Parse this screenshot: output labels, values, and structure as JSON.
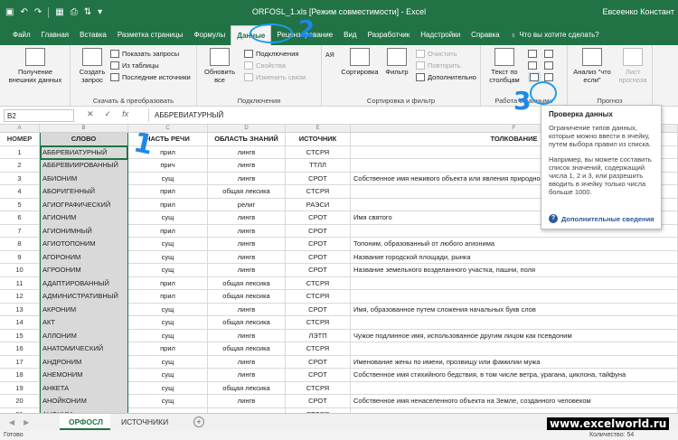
{
  "title_bar": {
    "document_title": "ORFOSL_1.xls [Режим совместимости] - Excel",
    "user": "Евсеенко Констант"
  },
  "tabs": [
    {
      "label": "Файл"
    },
    {
      "label": "Главная"
    },
    {
      "label": "Вставка"
    },
    {
      "label": "Разметка страницы"
    },
    {
      "label": "Формулы"
    },
    {
      "label": "Данные",
      "active": true
    },
    {
      "label": "Рецензирование"
    },
    {
      "label": "Вид"
    },
    {
      "label": "Разработчик"
    },
    {
      "label": "Надстройки"
    },
    {
      "label": "Справка"
    }
  ],
  "tell_me": "Что вы хотите сделать?",
  "ribbon": {
    "get_external": "Получение внешних данных",
    "create_query": "Создать запрос",
    "show_queries": "Показать запросы",
    "from_table": "Из таблицы",
    "recent_sources": "Последние источники",
    "group_get_transform": "Скачать & преобразовать",
    "refresh_all": "Обновить все",
    "connections": "Подключения",
    "properties": "Свойства",
    "edit_links": "Изменить связи",
    "group_connections": "Подключения",
    "sort_az": "АЯ",
    "sort": "Сортировка",
    "filter": "Фильтр",
    "clear": "Очистить",
    "reapply": "Повторить",
    "advanced": "Дополнительно",
    "group_sort_filter": "Сортировка и фильтр",
    "text_to_columns": "Текст по столбцам",
    "group_data_tools": "Работа с данными",
    "what_if": "Анализ \"что если\"",
    "forecast_sheet": "Лист прогноза",
    "group_forecast": "Прогноз"
  },
  "formula_bar": {
    "name_box": "B2",
    "fx": "fx",
    "value": "АББРЕВИАТУРНЫЙ"
  },
  "columns": [
    "A",
    "B",
    "C",
    "D",
    "E",
    "F"
  ],
  "headers": [
    "НОМЕР",
    "СЛОВО",
    "ЧАСТЬ РЕЧИ",
    "ОБЛАСТЬ ЗНАНИЙ",
    "ИСТОЧНИК",
    "ТОЛКОВАНИЕ"
  ],
  "rows": [
    [
      "1",
      "АББРЕВИАТУРНЫЙ",
      "прил",
      "лингв",
      "СТСРЯ",
      ""
    ],
    [
      "2",
      "АББРЕВИИРОВАННЫЙ",
      "прич",
      "лингв",
      "ТТЛЛ",
      ""
    ],
    [
      "3",
      "АБИОНИМ",
      "сущ",
      "лингв",
      "СРОТ",
      "Собственное имя неживого объекта или явления природного мира"
    ],
    [
      "4",
      "АБОРИГЕННЫЙ",
      "прил",
      "общая лексика",
      "СТСРЯ",
      ""
    ],
    [
      "5",
      "АГИОГРАФИЧЕСКИЙ",
      "прил",
      "религ",
      "РАЭСИ",
      ""
    ],
    [
      "6",
      "АГИОНИМ",
      "сущ",
      "лингв",
      "СРОТ",
      "Имя святого"
    ],
    [
      "7",
      "АГИОНИМНЫЙ",
      "прил",
      "лингв",
      "СРОТ",
      ""
    ],
    [
      "8",
      "АГИОТОПОНИМ",
      "сущ",
      "лингв",
      "СРОТ",
      "Топоним, образованный от любого агионима"
    ],
    [
      "9",
      "АГОРОНИМ",
      "сущ",
      "лингв",
      "СРОТ",
      "Название городской площади, рынка"
    ],
    [
      "10",
      "АГРООНИМ",
      "сущ",
      "лингв",
      "СРОТ",
      "Название земельного возделанного участка, пашни, поля"
    ],
    [
      "11",
      "АДАПТИРОВАННЫЙ",
      "прил",
      "общая лексика",
      "СТСРЯ",
      ""
    ],
    [
      "12",
      "АДМИНИСТРАТИВНЫЙ",
      "прил",
      "общая лексика",
      "СТСРЯ",
      ""
    ],
    [
      "13",
      "АКРОНИМ",
      "сущ",
      "лингв",
      "СРОТ",
      "Имя, образованное путем сложения начальных букв слов"
    ],
    [
      "14",
      "АКТ",
      "сущ",
      "общая лексика",
      "СТСРЯ",
      ""
    ],
    [
      "15",
      "АЛЛОНИМ",
      "сущ",
      "лингв",
      "ЛЭТП",
      "Чужое подлинное имя, использованное другим лицом как псевдоним"
    ],
    [
      "16",
      "АНАТОМИЧЕСКИЙ",
      "прил",
      "общая лексика",
      "СТСРЯ",
      ""
    ],
    [
      "17",
      "АНДРОНИМ",
      "сущ",
      "лингв",
      "СРОТ",
      "Именование жены по имени, прозвищу или фамилии мужа"
    ],
    [
      "18",
      "АНЕМОНИМ",
      "сущ",
      "лингв",
      "СРОТ",
      "Собственное имя стихийного бедствия, в том числе ветра, урагана, циклона, тайфуна"
    ],
    [
      "19",
      "АНКЕТА",
      "сущ",
      "общая лексика",
      "СТСРЯ",
      ""
    ],
    [
      "20",
      "АНОЙКОНИМ",
      "сущ",
      "лингв",
      "СРОТ",
      "Собственное имя ненаселенного объекта на Земле, созданного человеком"
    ],
    [
      "21",
      "АНОНИМ",
      "сущ",
      "лингв",
      "СТСРЯ",
      ""
    ]
  ],
  "tooltip": {
    "title": "Проверка данных",
    "p1": "Ограничение типов данных, которые можно ввести в ячейку, путем выбора правил из списка.",
    "p2": "Например, вы можете составить список значений, содержащий числа 1, 2 и 3, или разрешить вводить в ячейку только числа больше 1000.",
    "more": "Дополнительные сведения"
  },
  "sheet_tabs": [
    "ОРФОСЛ",
    "ИСТОЧНИКИ"
  ],
  "status": {
    "ready": "Готово",
    "count": "Количество: 54"
  },
  "watermark": "www.excelworld.ru",
  "annotations": [
    "1",
    "2",
    "3"
  ],
  "colors": {
    "excel_green": "#217346",
    "annotation_blue": "#1e9bf0"
  }
}
